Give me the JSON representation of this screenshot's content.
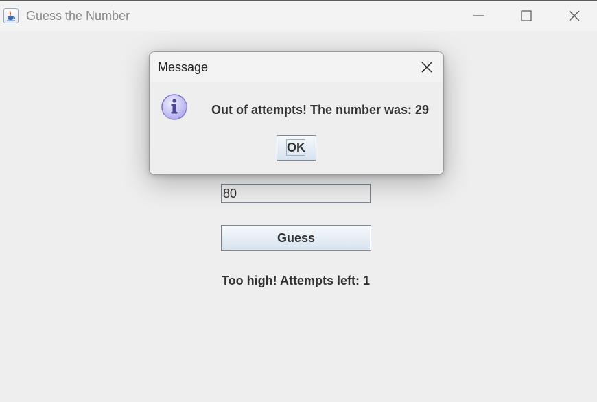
{
  "window": {
    "title": "Guess the Number",
    "icon": "java-cup-icon"
  },
  "form": {
    "guess_value": "80",
    "guess_button_label": "Guess",
    "result_text": "Too high! Attempts left: 1"
  },
  "dialog": {
    "title": "Message",
    "icon": "info-icon",
    "message": "Out of attempts! The number was: 29",
    "ok_label": "OK"
  },
  "colors": {
    "background": "#eeeeee",
    "titlebar": "#f3f3f3",
    "button_gradient_top": "#f6f9fc",
    "button_gradient_bottom": "#d6e3ef",
    "info_icon_fill": "#c9c6f4"
  }
}
